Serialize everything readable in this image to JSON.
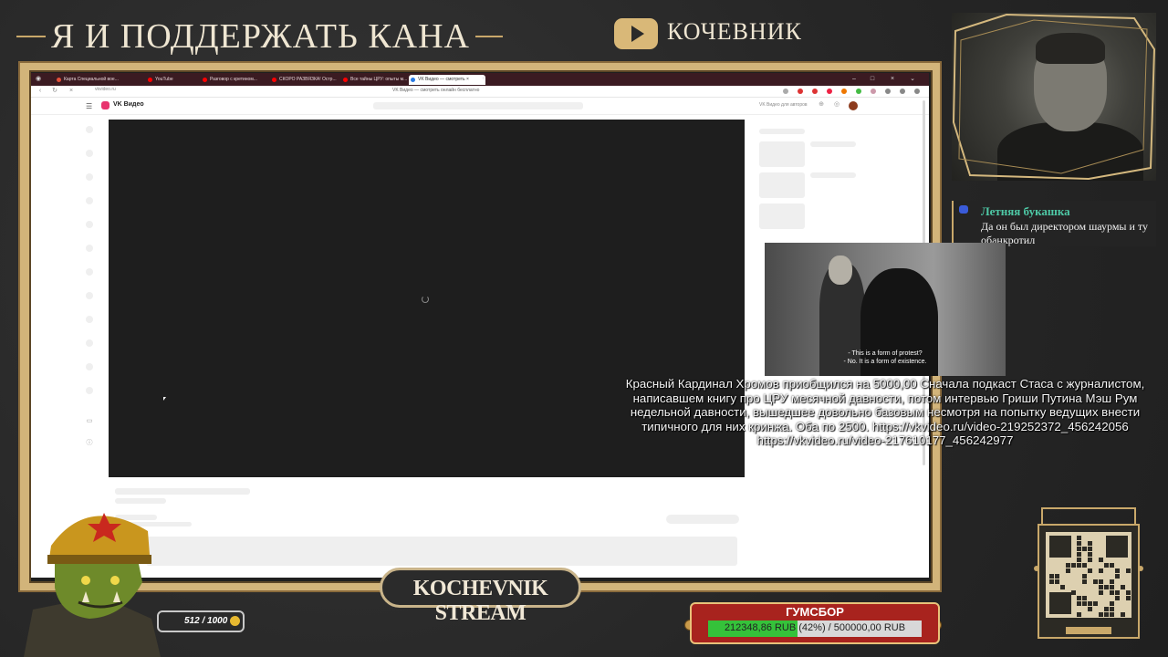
{
  "banner": {
    "title": "Я И ПОДДЕРЖАТЬ КАНА",
    "channel_name": "КОЧЕВНИК"
  },
  "browser": {
    "tabs": [
      {
        "label": "Карта Специальной вое...",
        "color": "#e2503a"
      },
      {
        "label": "YouTube",
        "color": "#ff0000"
      },
      {
        "label": "Разговор с кретином...",
        "color": "#ff0000"
      },
      {
        "label": "СКОРО РАЗВЯЗКА! Остр...",
        "color": "#ff0000"
      },
      {
        "label": "Все тайны ЦРУ: опыты м...",
        "color": "#ff0000"
      },
      {
        "label": "VK Видео — смотреть ×",
        "color": "#2a7be4"
      }
    ],
    "url": "vkvideo.ru",
    "page_title": "VK Видео — смотреть онлайн бесплатно",
    "site_name": "VK Видео",
    "author_link": "VK Видео для авторов"
  },
  "chat": {
    "username": "Летняя букашка",
    "message": "Да он был директором шаурмы и ту обанкротил"
  },
  "film": {
    "subtitle_1": "- This is a form of protest?",
    "subtitle_2": "- No. It is a form of existence."
  },
  "donation": {
    "text": "Красный Кардинал Хромов  приобщился на 5000,00  Сначала подкаст Стаса с журналистом, написавшем книгу про ЦРУ месячной давности, потом интервью Гриши Путина Мэш Рум недельной давности, вышедшее довольно базовым несмотря на попытку ведущих внести типичного для них кринжа. Оба по 2500. https://vkvideo.ru/video-219252372_456242056 https://vkvideo.ru/video-217610177_456242977"
  },
  "stream_badge": "KOCHEVNIK STREAM",
  "mini_counter": {
    "text": "512 / 1000"
  },
  "goal": {
    "title": "ГУМСБОР",
    "label": "212348,86 RUB (42%) / 500000,00 RUB",
    "progress": 0.42
  },
  "colors": {
    "accent_gold": "#c9a86a",
    "chat_username": "#4ec9a6",
    "goal_fill": "#35c23a",
    "goal_bg": "#a8231e"
  }
}
